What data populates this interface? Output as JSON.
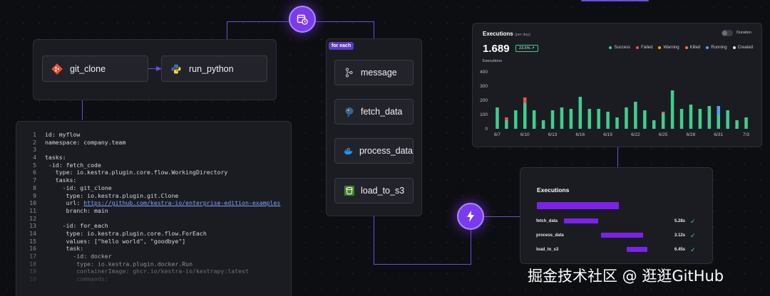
{
  "flow_top": {
    "git_clone_label": "git_clone",
    "run_python_label": "run_python"
  },
  "foreach": {
    "badge": "for each",
    "tasks": [
      "message",
      "fetch_data",
      "process_data",
      "load_to_s3"
    ]
  },
  "code": {
    "lines": [
      {
        "n": "1",
        "t": "id: myflow"
      },
      {
        "n": "2",
        "t": "namespace: company.team"
      },
      {
        "n": "3",
        "t": ""
      },
      {
        "n": "4",
        "t": "tasks:"
      },
      {
        "n": "5",
        "t": " -id: fetch_code"
      },
      {
        "n": "6",
        "t": "   type: io.kestra.plugin.core.flow.WorkingDirectory"
      },
      {
        "n": "7",
        "t": "   tasks:"
      },
      {
        "n": "8",
        "t": "     -id: git_clone"
      },
      {
        "n": "9",
        "t": "      type: io.kestra.plugin.git.Clone"
      },
      {
        "n": "10",
        "t": "      url: ",
        "url": "https://github.com/kestra-io/enterprise-edition-examples"
      },
      {
        "n": "11",
        "t": "      branch: main"
      },
      {
        "n": "12",
        "t": ""
      },
      {
        "n": "13",
        "t": "     -id: for_each"
      },
      {
        "n": "14",
        "t": "      type: io.kestra.plugin.core.flow.ForEach"
      },
      {
        "n": "15",
        "t": "      values: [\"hello world\", \"goodbye\"]"
      },
      {
        "n": "16",
        "t": "      task:"
      },
      {
        "n": "17",
        "t": "        -id: docker"
      },
      {
        "n": "18",
        "t": "         type: io.kestra.plugin.docker.Run"
      },
      {
        "n": "19",
        "t": "         containerImage: ghcr.io/kestra-io/kestrapy:latest"
      },
      {
        "n": "20",
        "t": "         commands:"
      }
    ]
  },
  "executions_chart": {
    "title": "Executions",
    "subtitle": "(per day)",
    "total": "1.689",
    "change": "23.5% ↗",
    "toggle_label": "Duration",
    "y_axis_label": "Executions",
    "legend": [
      {
        "label": "Success",
        "color": "#3ecf8e"
      },
      {
        "label": "Failed",
        "color": "#ef5350"
      },
      {
        "label": "Warning",
        "color": "#f59e0b"
      },
      {
        "label": "Killed",
        "color": "#ff7043"
      },
      {
        "label": "Running",
        "color": "#4aa3ff"
      },
      {
        "label": "Created",
        "color": "#e0e0e6"
      }
    ]
  },
  "chart_data": {
    "type": "bar",
    "ylabel": "Executions",
    "ylim": [
      0,
      400
    ],
    "yticks": [
      "400",
      "300",
      "200",
      "100",
      "0"
    ],
    "xticks": [
      "6/7",
      "6/10",
      "6/13",
      "6/16",
      "6/19",
      "6/22",
      "6/25",
      "6/28",
      "6/31",
      "7/3"
    ],
    "series": [
      {
        "name": "Success",
        "values": [
          150,
          60,
          130,
          180,
          130,
          60,
          130,
          150,
          140,
          225,
          140,
          140,
          120,
          80,
          150,
          190,
          130,
          60,
          110,
          270,
          140,
          170,
          140,
          160,
          100,
          130,
          60,
          80
        ]
      },
      {
        "name": "Failed",
        "values": [
          0,
          20,
          0,
          40,
          0,
          0,
          0,
          0,
          0,
          0,
          0,
          0,
          0,
          0,
          0,
          0,
          0,
          0,
          10,
          0,
          0,
          0,
          0,
          0,
          0,
          0,
          0,
          0
        ]
      },
      {
        "name": "Running",
        "values": [
          0,
          0,
          0,
          0,
          0,
          0,
          0,
          0,
          0,
          0,
          0,
          0,
          0,
          0,
          0,
          0,
          0,
          0,
          0,
          0,
          0,
          0,
          0,
          0,
          60,
          0,
          0,
          0
        ]
      }
    ]
  },
  "executions_panel": {
    "title": "Executions",
    "rows": [
      {
        "label": "fetch_data",
        "time": "5.28s",
        "start": 0.0,
        "width": 0.37
      },
      {
        "label": "process_data",
        "time": "3.12s",
        "start": 0.4,
        "width": 0.45
      },
      {
        "label": "load_to_s3",
        "time": "6.45s",
        "start": 0.68,
        "width": 0.22
      }
    ]
  },
  "watermark": "掘金技术社区 @ 逛逛GitHub"
}
